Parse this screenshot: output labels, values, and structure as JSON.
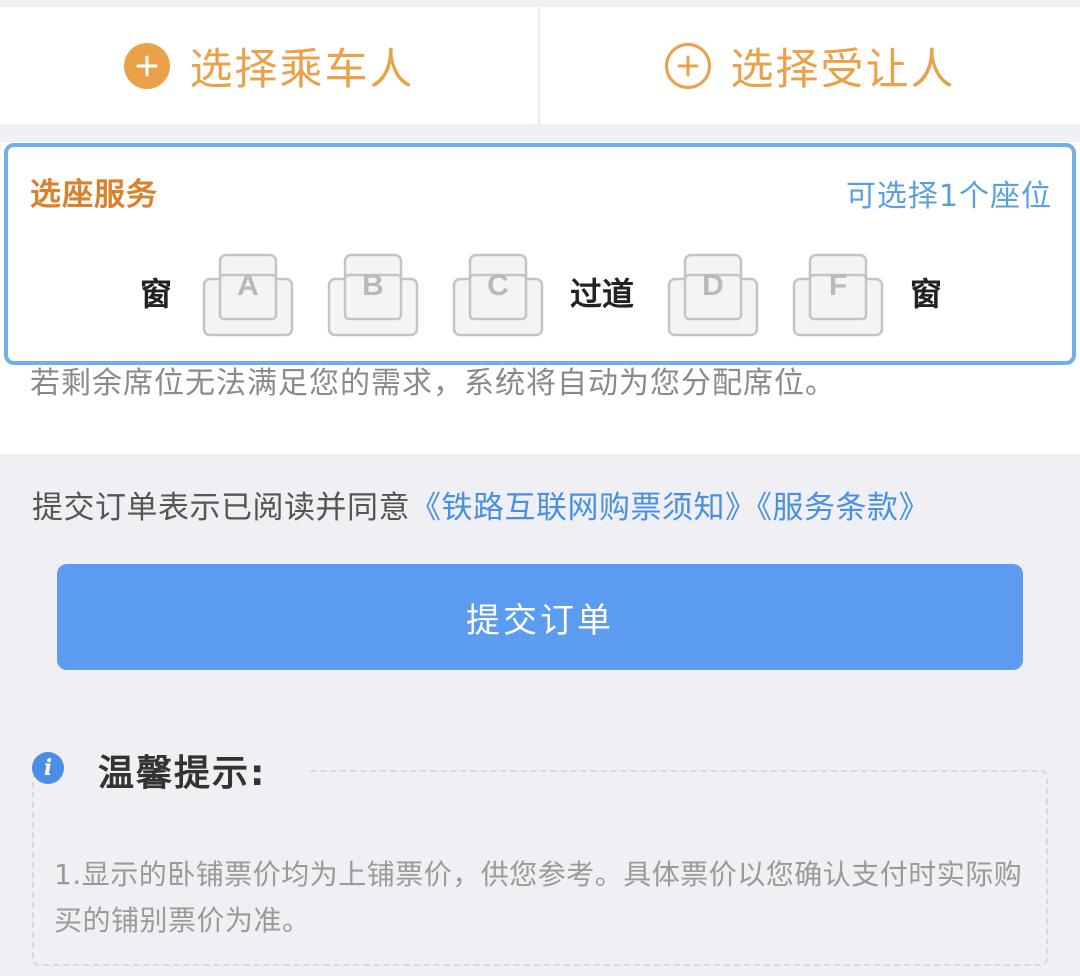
{
  "top_bar": {
    "select_passenger_label": "选择乘车人",
    "select_transferee_label": "选择受让人"
  },
  "seat_service": {
    "title": "选座服务",
    "hint": "可选择1个座位",
    "window_label": "窗",
    "aisle_label": "过道",
    "seats": [
      "A",
      "B",
      "C",
      "D",
      "F"
    ]
  },
  "notice": {
    "text": "若剩余席位无法满足您的需求，系统将自动为您分配席位。"
  },
  "agreement": {
    "prefix": "提交订单表示已阅读并同意",
    "rules_link": "《铁路互联网购票须知》",
    "terms_link": "《服务条款》"
  },
  "submit_button": {
    "label": "提交订单"
  },
  "tips": {
    "title": "温馨提示:",
    "items": [
      "1.显示的卧铺票价均为上铺票价，供您参考。具体票价以您确认支付时实际购买的铺别票价为准。"
    ]
  },
  "colors": {
    "accent_orange": "#e9a24a",
    "link_blue": "#4a90e2",
    "button_blue": "#5b9bf0"
  }
}
